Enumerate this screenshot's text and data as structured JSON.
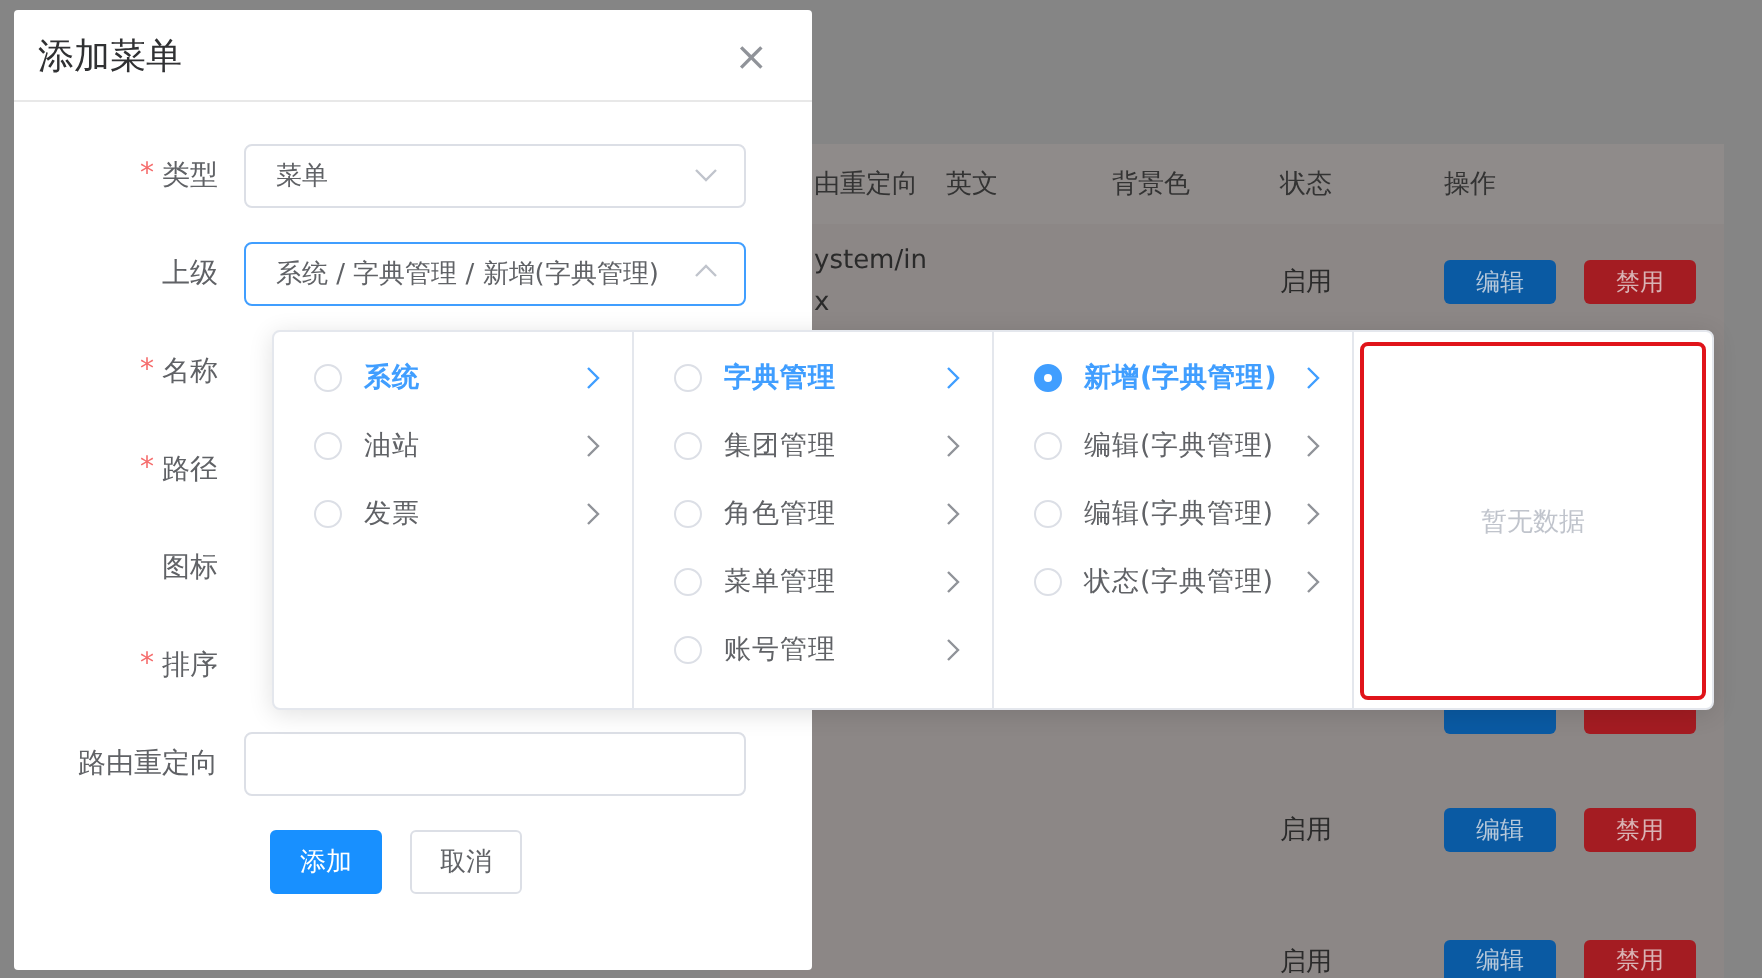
{
  "table": {
    "columns": [
      "由重定向",
      "英文",
      "背景色",
      "状态",
      "操作"
    ],
    "rows": [
      {
        "path_lines": [
          "ystem/in",
          "x"
        ],
        "status": "启用",
        "actions": [
          {
            "kind": "edit",
            "label": "编辑"
          },
          {
            "kind": "disable",
            "label": "禁用"
          }
        ]
      },
      {
        "actions": [
          {
            "kind": "edit"
          },
          {
            "kind": "disable"
          }
        ]
      },
      {
        "status": "启用",
        "actions": [
          {
            "kind": "edit",
            "label": "编辑"
          },
          {
            "kind": "disable",
            "label": "禁用"
          }
        ]
      },
      {
        "status": "启用",
        "actions": [
          {
            "kind": "edit",
            "label": "编辑"
          },
          {
            "kind": "disable",
            "label": "禁用"
          }
        ]
      }
    ]
  },
  "dialog": {
    "title": "添加菜单",
    "close": "×",
    "fields": [
      {
        "label": "类型",
        "required_mark": "*",
        "kind": "select",
        "value": "菜单",
        "focused": false
      },
      {
        "label": "上级",
        "kind": "select",
        "value": "系统 / 字典管理 / 新增(字典管理)",
        "focused": true
      },
      {
        "label": "名称",
        "required_mark": "*",
        "kind": "covered"
      },
      {
        "label": "路径",
        "required_mark": "*",
        "kind": "covered"
      },
      {
        "label": "图标",
        "kind": "covered"
      },
      {
        "label": "排序",
        "required_mark": "*",
        "kind": "covered"
      },
      {
        "label": "路由重定向",
        "kind": "input"
      }
    ],
    "buttons": [
      {
        "label": "添加",
        "primary": true
      },
      {
        "label": "取消",
        "primary": false
      }
    ]
  },
  "cascader": {
    "columns": [
      [
        {
          "label": "系统",
          "active": true,
          "checked": false
        },
        {
          "label": "油站",
          "active": false,
          "checked": false
        },
        {
          "label": "发票",
          "active": false,
          "checked": false
        }
      ],
      [
        {
          "label": "字典管理",
          "active": true,
          "checked": false
        },
        {
          "label": "集团管理",
          "active": false,
          "checked": false
        },
        {
          "label": "角色管理",
          "active": false,
          "checked": false
        },
        {
          "label": "菜单管理",
          "active": false,
          "checked": false
        },
        {
          "label": "账号管理",
          "active": false,
          "checked": false
        }
      ],
      [
        {
          "label": "新增(字典管理)",
          "active": true,
          "checked": true
        },
        {
          "label": "编辑(字典管理)",
          "active": false,
          "checked": false
        },
        {
          "label": "编辑(字典管理)",
          "active": false,
          "checked": false
        },
        {
          "label": "状态(字典管理)",
          "active": false,
          "checked": false
        }
      ]
    ],
    "empty_text": "暂无数据"
  }
}
